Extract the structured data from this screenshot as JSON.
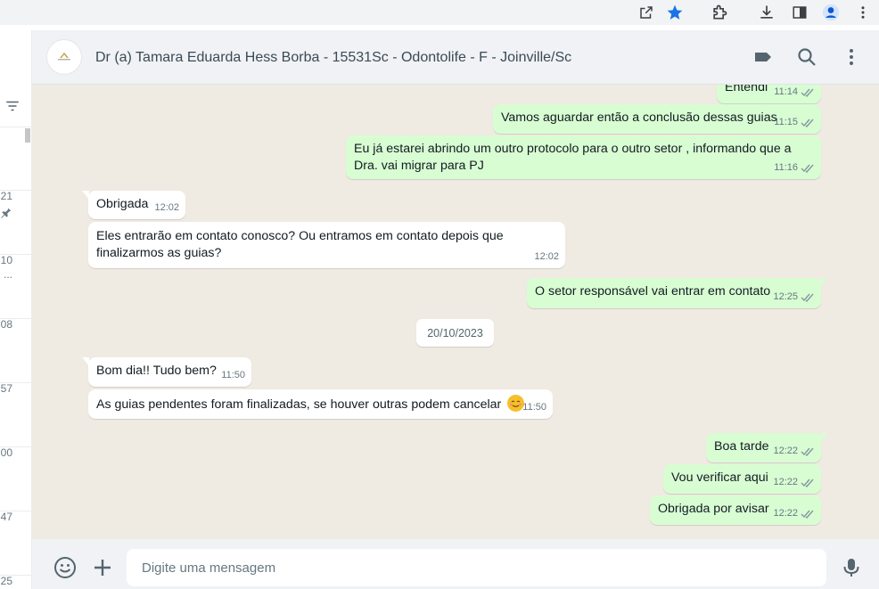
{
  "browser": {
    "icons": [
      "open-external-icon",
      "bookmark-star-icon",
      "extensions-icon",
      "download-icon",
      "side-panel-icon",
      "profile-icon",
      "more-vert-icon"
    ],
    "accent": "#1a73e8"
  },
  "sidebar": {
    "times": [
      "21",
      "10",
      "08",
      "57",
      "00",
      "47",
      "25"
    ],
    "ellipsis": "..."
  },
  "header": {
    "title": "Dr (a) Tamara Eduarda Hess Borba - 15531Sc - Odontolife - F - Joinville/Sc"
  },
  "messages": [
    {
      "dir": "out",
      "text": "Entendi",
      "time": "11:14"
    },
    {
      "dir": "out",
      "text": "Vamos aguardar então a conclusão dessas guias",
      "time": "11:15"
    },
    {
      "dir": "out",
      "lines": [
        "Eu já estarei abrindo um outro protocolo para o outro setor , informando que a",
        "Dra. vai migrar para PJ"
      ],
      "time": "11:16"
    },
    {
      "dir": "in",
      "text": "Obrigada",
      "time": "12:02"
    },
    {
      "dir": "in",
      "lines": [
        "Eles entrarão em contato conosco? Ou entramos em contato depois que",
        "finalizarmos as guias?"
      ],
      "time": "12:02"
    },
    {
      "dir": "out",
      "text": "O setor responsável vai entrar em contato",
      "time": "12:25"
    },
    {
      "dir": "in",
      "text": "Bom dia!! Tudo bem?",
      "time": "11:50"
    },
    {
      "dir": "in",
      "text": "As guias pendentes foram finalizadas, se houver outras podem cancelar",
      "time": "11:50"
    },
    {
      "dir": "out",
      "text": "Boa tarde",
      "time": "12:22"
    },
    {
      "dir": "out",
      "text": "Vou verificar aqui",
      "time": "12:22"
    },
    {
      "dir": "out",
      "text": "Obrigada por avisar",
      "time": "12:22"
    }
  ],
  "date_divider": "20/10/2023",
  "composer": {
    "placeholder": "Digite uma mensagem"
  },
  "colors": {
    "outgoing_bubble": "#d9fdd3",
    "incoming_bubble": "#ffffff",
    "chat_background": "#efeae2",
    "panel": "#f0f2f5"
  }
}
